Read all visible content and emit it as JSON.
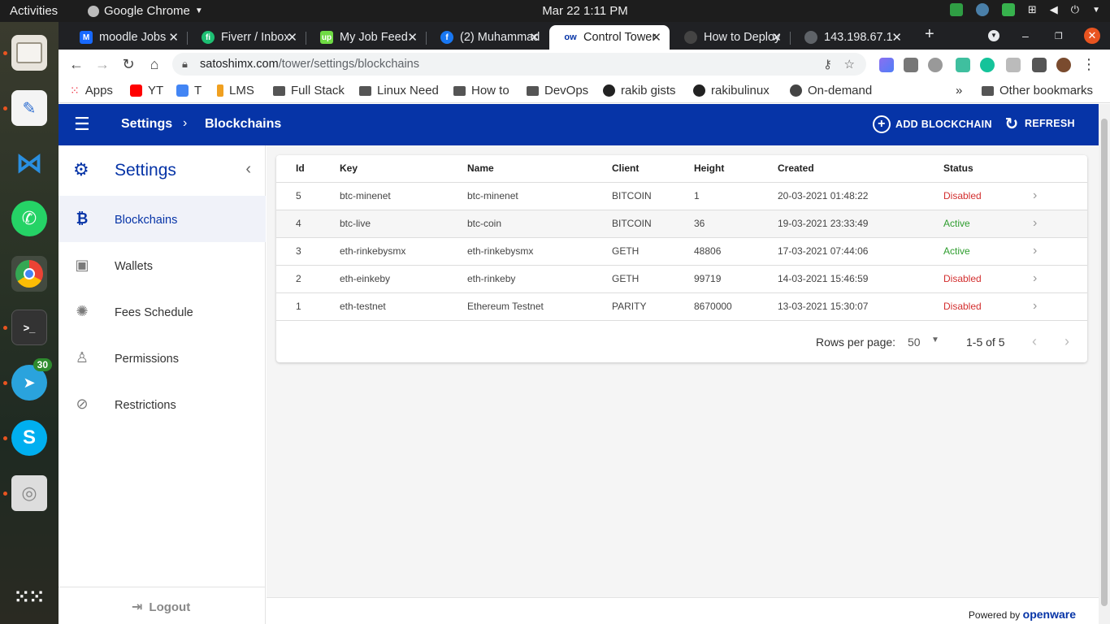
{
  "desktop": {
    "activities": "Activities",
    "app_name": "Google Chrome",
    "clock": "Mar 22  1:11 PM"
  },
  "dock": {
    "telegram_badge": "30"
  },
  "tabs": [
    {
      "label": "moodle Jobs",
      "fav_color": "#1769ff"
    },
    {
      "label": "Fiverr / Inbox",
      "fav_color": "#1dbf73"
    },
    {
      "label": "My Job Feed",
      "fav_color": "#6fda44"
    },
    {
      "label": "(2) Muhammad",
      "fav_color": "#1877f2"
    },
    {
      "label": "Control Tower",
      "fav_color": "#ffffff"
    },
    {
      "label": "How to Deploy",
      "fav_color": "#333333"
    },
    {
      "label": "143.198.67.1",
      "fav_color": "#5f6368"
    }
  ],
  "address": {
    "domain": "satoshimx.com",
    "path": "/tower/settings/blockchains"
  },
  "bookmarks": [
    "Apps",
    "YT",
    "T",
    "LMS",
    "Full Stack",
    "Linux Need",
    "How to",
    "DevOps",
    "rakib gists",
    "rakibulinux",
    "On-demand"
  ],
  "other_bookmarks": "Other bookmarks",
  "appbar": {
    "crumb1": "Settings",
    "crumb2": "Blockchains",
    "add_label": "ADD BLOCKCHAIN",
    "refresh_label": "REFRESH"
  },
  "sidebar": {
    "title": "Settings",
    "items": [
      {
        "label": "Blockchains"
      },
      {
        "label": "Wallets"
      },
      {
        "label": "Fees Schedule"
      },
      {
        "label": "Permissions"
      },
      {
        "label": "Restrictions"
      }
    ],
    "logout": "Logout"
  },
  "table": {
    "headers": [
      "Id",
      "Key",
      "Name",
      "Client",
      "Height",
      "Created",
      "Status"
    ],
    "rows": [
      {
        "id": "5",
        "key": "btc-minenet",
        "name": "btc-minenet",
        "client": "BITCOIN",
        "height": "1",
        "created": "20-03-2021 01:48:22",
        "status": "Disabled"
      },
      {
        "id": "4",
        "key": "btc-live",
        "name": "btc-coin",
        "client": "BITCOIN",
        "height": "36",
        "created": "19-03-2021 23:33:49",
        "status": "Active"
      },
      {
        "id": "3",
        "key": "eth-rinkebysmx",
        "name": "eth-rinkebysmx",
        "client": "GETH",
        "height": "48806",
        "created": "17-03-2021 07:44:06",
        "status": "Active"
      },
      {
        "id": "2",
        "key": "eth-einkeby",
        "name": "eth-rinkeby",
        "client": "GETH",
        "height": "99719",
        "created": "14-03-2021 15:46:59",
        "status": "Disabled"
      },
      {
        "id": "1",
        "key": "eth-testnet",
        "name": "Ethereum Testnet",
        "client": "PARITY",
        "height": "8670000",
        "created": "13-03-2021 15:30:07",
        "status": "Disabled"
      }
    ]
  },
  "pager": {
    "rows_per_page_label": "Rows per page:",
    "rows_per_page": "50",
    "range": "1-5 of 5"
  },
  "footer": {
    "powered_by": "Powered by",
    "brand": "openware"
  },
  "colors": {
    "brand_blue": "#0634a7",
    "disabled_red": "#d32f2f",
    "active_green": "#2e9d2e"
  }
}
